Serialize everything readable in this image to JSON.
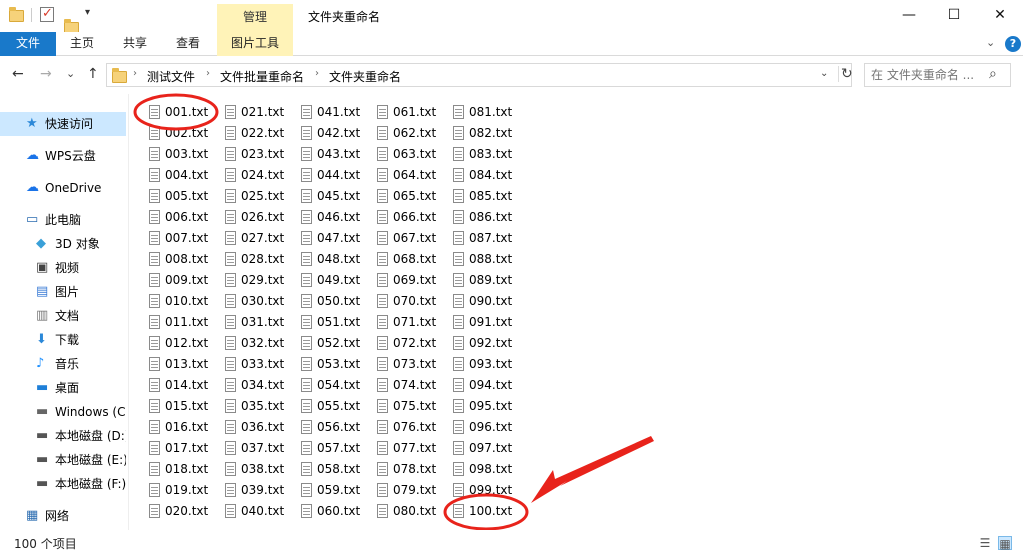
{
  "window": {
    "title": "文件夹重命名",
    "context_tab_header": "管理",
    "qa_dropdown": "▾",
    "controls": {
      "minimize": "—",
      "maximize": "☐",
      "close": "✕"
    }
  },
  "ribbon": {
    "tabs": [
      "文件",
      "主页",
      "共享",
      "查看",
      "图片工具"
    ],
    "expand": "⌄",
    "help": "?"
  },
  "nav": {
    "back": "←",
    "forward": "→",
    "recent": "⌄",
    "up": "↑"
  },
  "address": {
    "crumbs": [
      "测试文件",
      "文件批量重命名",
      "文件夹重命名"
    ],
    "separator": "›",
    "dropdown": "⌄",
    "refresh": "↻"
  },
  "search": {
    "placeholder": "在 文件夹重命名 ...",
    "icon": "⌕"
  },
  "sidebar": {
    "items": [
      {
        "label": "快速访问",
        "icon": "star-icon"
      },
      {
        "label": "WPS云盘",
        "icon": "cloud-icon"
      },
      {
        "label": "OneDrive",
        "icon": "cloud-icon"
      },
      {
        "label": "此电脑",
        "icon": "computer-icon"
      },
      {
        "label": "3D 对象",
        "icon": "cube-icon"
      },
      {
        "label": "视频",
        "icon": "video-icon"
      },
      {
        "label": "图片",
        "icon": "picture-icon"
      },
      {
        "label": "文档",
        "icon": "document-icon"
      },
      {
        "label": "下载",
        "icon": "download-icon"
      },
      {
        "label": "音乐",
        "icon": "music-icon"
      },
      {
        "label": "桌面",
        "icon": "desktop-icon"
      },
      {
        "label": "Windows (C:",
        "icon": "windows-drive-icon"
      },
      {
        "label": "本地磁盘 (D:)",
        "icon": "drive-icon"
      },
      {
        "label": "本地磁盘 (E:)",
        "icon": "drive-icon"
      },
      {
        "label": "本地磁盘 (F:)",
        "icon": "drive-icon"
      },
      {
        "label": "网络",
        "icon": "network-icon"
      }
    ]
  },
  "files": [
    "001.txt",
    "002.txt",
    "003.txt",
    "004.txt",
    "005.txt",
    "006.txt",
    "007.txt",
    "008.txt",
    "009.txt",
    "010.txt",
    "011.txt",
    "012.txt",
    "013.txt",
    "014.txt",
    "015.txt",
    "016.txt",
    "017.txt",
    "018.txt",
    "019.txt",
    "020.txt",
    "021.txt",
    "022.txt",
    "023.txt",
    "024.txt",
    "025.txt",
    "026.txt",
    "027.txt",
    "028.txt",
    "029.txt",
    "030.txt",
    "031.txt",
    "032.txt",
    "033.txt",
    "034.txt",
    "035.txt",
    "036.txt",
    "037.txt",
    "038.txt",
    "039.txt",
    "040.txt",
    "041.txt",
    "042.txt",
    "043.txt",
    "044.txt",
    "045.txt",
    "046.txt",
    "047.txt",
    "048.txt",
    "049.txt",
    "050.txt",
    "051.txt",
    "052.txt",
    "053.txt",
    "054.txt",
    "055.txt",
    "056.txt",
    "057.txt",
    "058.txt",
    "059.txt",
    "060.txt",
    "061.txt",
    "062.txt",
    "063.txt",
    "064.txt",
    "065.txt",
    "066.txt",
    "067.txt",
    "068.txt",
    "069.txt",
    "070.txt",
    "071.txt",
    "072.txt",
    "073.txt",
    "074.txt",
    "075.txt",
    "076.txt",
    "077.txt",
    "078.txt",
    "079.txt",
    "080.txt",
    "081.txt",
    "082.txt",
    "083.txt",
    "084.txt",
    "085.txt",
    "086.txt",
    "087.txt",
    "088.txt",
    "089.txt",
    "090.txt",
    "091.txt",
    "092.txt",
    "093.txt",
    "094.txt",
    "095.txt",
    "096.txt",
    "097.txt",
    "098.txt",
    "099.txt",
    "100.txt"
  ],
  "status": {
    "item_count": "100 个项目",
    "view_details": "☰",
    "view_thumbnails": "▦"
  },
  "colors": {
    "accent": "#1979ca",
    "context_tab": "#fff3b8",
    "annotation": "#e8231b",
    "selected": "#cce8ff"
  }
}
